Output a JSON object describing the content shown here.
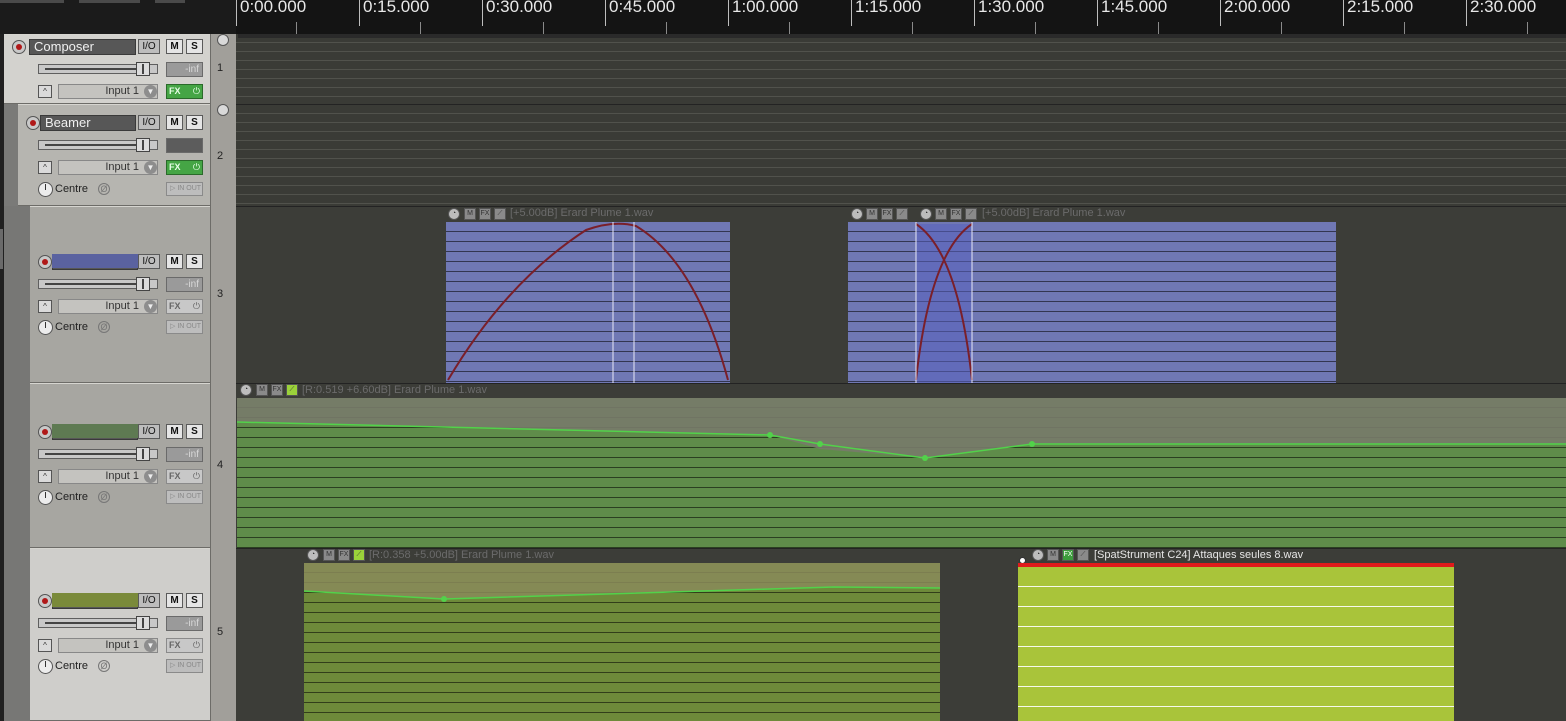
{
  "ruler": {
    "labels": [
      "0:00.000",
      "0:15.000",
      "0:30.000",
      "0:45.000",
      "1:00.000",
      "1:15.000",
      "1:30.000",
      "1:45.000",
      "2:00.000",
      "2:15.000",
      "2:30.000"
    ]
  },
  "tracks": [
    {
      "number": "1",
      "name": "Composer",
      "io": "I/O",
      "mute": "M",
      "solo": "S",
      "meter": "-inf",
      "input": "Input 1",
      "fx": "FX",
      "power": "⏻"
    },
    {
      "number": "2",
      "name": "Beamer",
      "io": "I/O",
      "mute": "M",
      "solo": "S",
      "meter": "",
      "input": "Input 1",
      "fx": "FX",
      "power": "⏻",
      "pan": "Centre",
      "phase": "Ø",
      "input_monitor": "▷ IN OUT"
    },
    {
      "number": "3",
      "name": "",
      "io": "I/O",
      "mute": "M",
      "solo": "S",
      "meter": "-inf",
      "input": "Input 1",
      "fx": "FX",
      "power": "⏻",
      "pan": "Centre",
      "phase": "Ø",
      "input_monitor": "▷ IN OUT",
      "color": "#5a62a0"
    },
    {
      "number": "4",
      "name": "",
      "io": "I/O",
      "mute": "M",
      "solo": "S",
      "meter": "-inf",
      "input": "Input 1",
      "fx": "FX",
      "power": "⏻",
      "pan": "Centre",
      "phase": "Ø",
      "input_monitor": "▷ IN OUT",
      "color": "#5e7a52"
    },
    {
      "number": "5",
      "name": "",
      "io": "I/O",
      "mute": "M",
      "solo": "S",
      "meter": "-inf",
      "input": "Input 1",
      "fx": "FX",
      "power": "⏻",
      "pan": "Centre",
      "phase": "Ø",
      "input_monitor": "▷ IN OUT",
      "color": "#7a8a3a"
    }
  ],
  "items": {
    "item_t3a": {
      "label": "[+5.00dB] Erard Plume 1.wav",
      "icons": [
        "◔",
        "M",
        "FX",
        "⟋"
      ]
    },
    "item_t3b": {
      "label": "",
      "icons": [
        "◔",
        "M",
        "FX",
        "⟋"
      ]
    },
    "item_t3c": {
      "label": "[+5.00dB] Erard Plume 1.wav",
      "icons": [
        "◔",
        "M",
        "FX",
        "⟋"
      ]
    },
    "item_t4": {
      "label": "[R:0.519 +6.60dB] Erard Plume 1.wav",
      "icons": [
        "◔",
        "M",
        "FX",
        "⟋"
      ]
    },
    "item_t5a": {
      "label": "[R:0.358 +5.00dB] Erard Plume 1.wav",
      "icons": [
        "◔",
        "M",
        "FX",
        "⟋"
      ]
    },
    "item_t5b": {
      "label": "[SpatStrument C24] Attaques seules 8.wav",
      "icons": [
        "◔",
        "M",
        "FX",
        "⟋"
      ]
    }
  },
  "colors": {
    "track3_item": "#7078b4",
    "track4_item": "#5f8c4a",
    "track5_item_a": "#6e8a3a",
    "track5_item_b": "#a9c43a",
    "envelope_curve": "#7a1f2a",
    "envelope_volume": "#52d24a",
    "selection_bar": "#e01b1b"
  }
}
